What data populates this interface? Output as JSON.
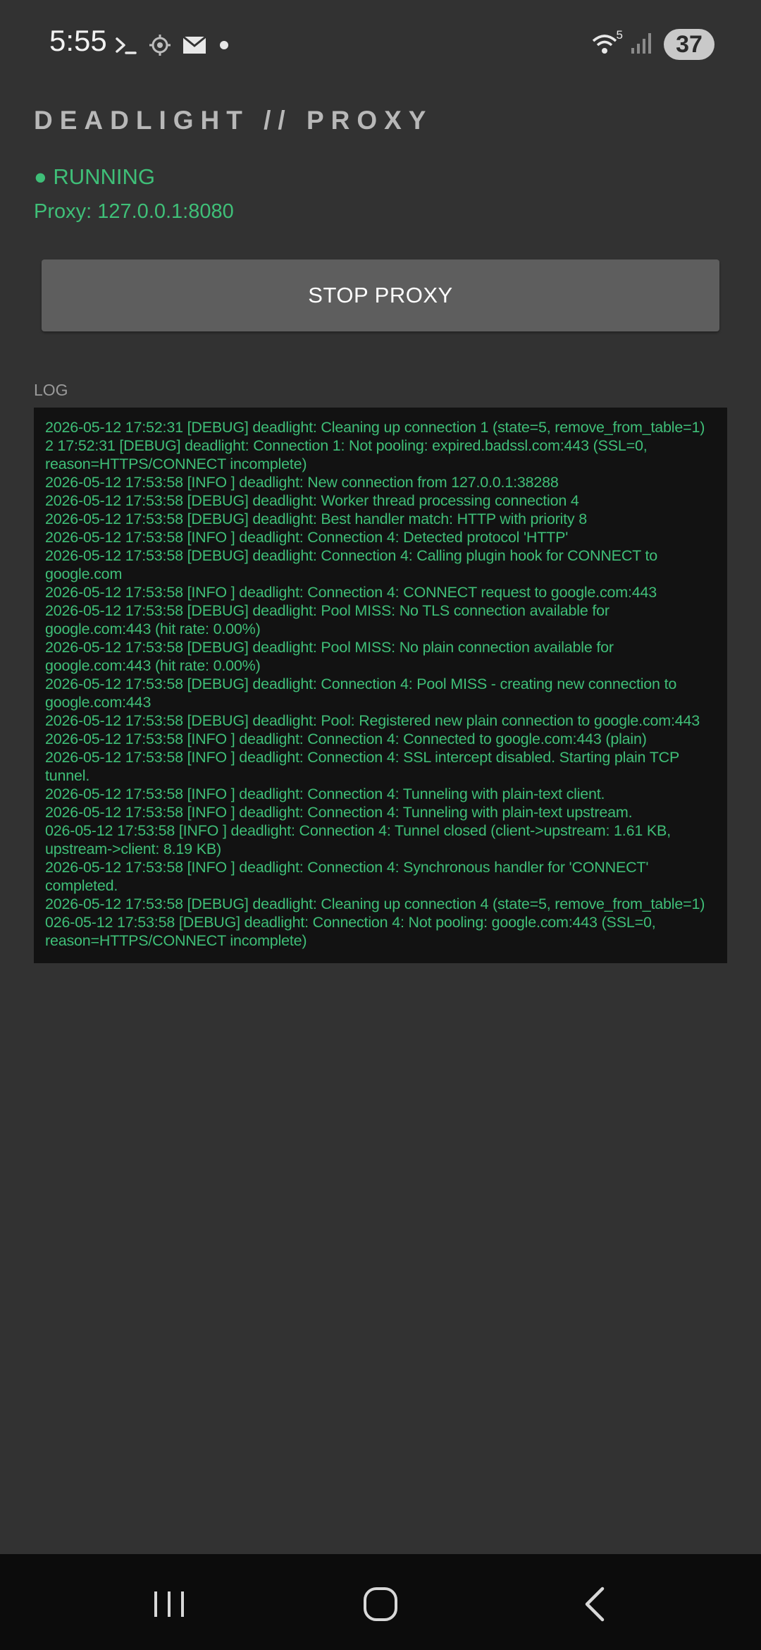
{
  "status_bar": {
    "time": "5:55",
    "icons_left": [
      "terminal-icon",
      "crosshair-icon",
      "mail-icon",
      "dot-icon"
    ],
    "wifi_label": "5",
    "battery": "37"
  },
  "app": {
    "title": "DEADLIGHT // PROXY",
    "status": "● RUNNING",
    "proxy_address": "Proxy: 127.0.0.1:8080",
    "stop_button_label": "STOP PROXY",
    "status_color": "#3fbf78"
  },
  "log": {
    "label": "LOG",
    "lines": [
      "2026-05-12 17:52:31 [DEBUG] deadlight: Cleaning up connection 1 (state=5, remove_from_table=1)",
      "2 17:52:31 [DEBUG] deadlight: Connection 1: Not pooling: expired.badssl.com:443 (SSL=0, reason=HTTPS/CONNECT incomplete)",
      "2026-05-12 17:53:58 [INFO ] deadlight: New connection from 127.0.0.1:38288",
      "2026-05-12 17:53:58 [DEBUG] deadlight: Worker thread processing connection 4",
      "2026-05-12 17:53:58 [DEBUG] deadlight: Best handler match: HTTP with priority 8",
      "2026-05-12 17:53:58 [INFO ] deadlight: Connection 4: Detected protocol 'HTTP'",
      "2026-05-12 17:53:58 [DEBUG] deadlight: Connection 4: Calling plugin hook for CONNECT to google.com",
      "2026-05-12 17:53:58 [INFO ] deadlight: Connection 4: CONNECT request to google.com:443",
      "2026-05-12 17:53:58 [DEBUG] deadlight: Pool MISS: No TLS connection available for google.com:443 (hit rate: 0.00%)",
      "2026-05-12 17:53:58 [DEBUG] deadlight: Pool MISS: No plain connection available for google.com:443 (hit rate: 0.00%)",
      "2026-05-12 17:53:58 [DEBUG] deadlight: Connection 4: Pool MISS - creating new connection to google.com:443",
      "2026-05-12 17:53:58 [DEBUG] deadlight: Pool: Registered new plain connection to google.com:443",
      "2026-05-12 17:53:58 [INFO ] deadlight: Connection 4: Connected to google.com:443 (plain)",
      "2026-05-12 17:53:58 [INFO ] deadlight: Connection 4: SSL intercept disabled. Starting plain TCP tunnel.",
      "2026-05-12 17:53:58 [INFO ] deadlight: Connection 4: Tunneling with plain-text client.",
      "2026-05-12 17:53:58 [INFO ] deadlight: Connection 4: Tunneling with plain-text upstream.",
      "026-05-12 17:53:58 [INFO ] deadlight: Connection 4: Tunnel closed (client->upstream: 1.61 KB, upstream->client: 8.19 KB)",
      "2026-05-12 17:53:58 [INFO ] deadlight: Connection 4: Synchronous handler for 'CONNECT' completed.",
      "2026-05-12 17:53:58 [DEBUG] deadlight: Cleaning up connection 4 (state=5, remove_from_table=1)",
      "026-05-12 17:53:58 [DEBUG] deadlight: Connection 4: Not pooling: google.com:443 (SSL=0, reason=HTTPS/CONNECT incomplete)"
    ]
  },
  "nav_bar": {
    "buttons": [
      "recent-apps-icon",
      "home-icon",
      "back-icon"
    ]
  }
}
